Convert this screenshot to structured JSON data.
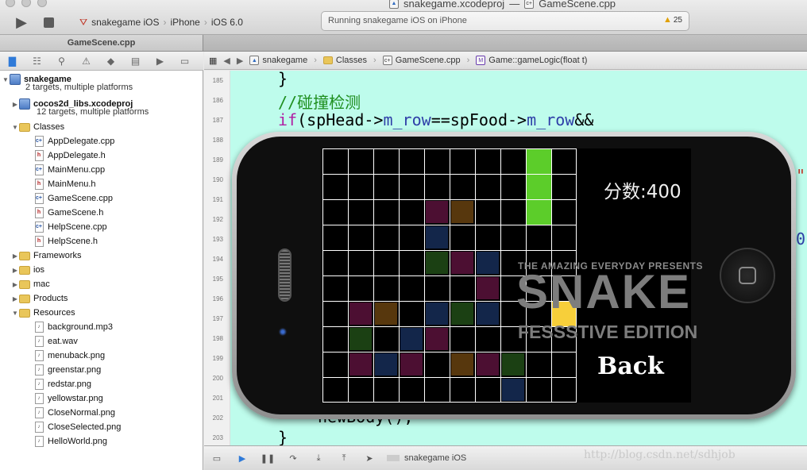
{
  "window": {
    "project_file": "snakegame.xcodeproj",
    "dash": "—",
    "source_file": "GameScene.cpp"
  },
  "toolbar": {
    "scheme": "snakegame iOS",
    "device": "iPhone",
    "os": "iOS 6.0",
    "status": "Running snakegame iOS on iPhone",
    "warnings": "25"
  },
  "tab": {
    "label": "GameScene.cpp"
  },
  "navigator": {
    "project": {
      "name": "snakegame",
      "subtitle": "2 targets, multiple platforms"
    },
    "libs": {
      "name": "cocos2d_libs.xcodeproj",
      "subtitle": "12 targets, multiple platforms"
    },
    "classes_label": "Classes",
    "classes": [
      {
        "name": "AppDelegate.cpp",
        "kind": "cpp"
      },
      {
        "name": "AppDelegate.h",
        "kind": "h"
      },
      {
        "name": "MainMenu.cpp",
        "kind": "cpp"
      },
      {
        "name": "MainMenu.h",
        "kind": "h"
      },
      {
        "name": "GameScene.cpp",
        "kind": "cpp"
      },
      {
        "name": "GameScene.h",
        "kind": "h"
      },
      {
        "name": "HelpScene.cpp",
        "kind": "cpp"
      },
      {
        "name": "HelpScene.h",
        "kind": "h"
      }
    ],
    "groups": [
      "Frameworks",
      "ios",
      "mac",
      "Products"
    ],
    "resources_label": "Resources",
    "resources": [
      "background.mp3",
      "eat.wav",
      "menuback.png",
      "greenstar.png",
      "redstar.png",
      "yellowstar.png",
      "CloseNormal.png",
      "CloseSelected.png",
      "HelloWorld.png"
    ]
  },
  "jumpbar": {
    "project": "snakegame",
    "group": "Classes",
    "file": "GameScene.cpp",
    "method_badge": "M",
    "method": "Game::gameLogic(float t)"
  },
  "editor": {
    "line_numbers": [
      "185",
      "186",
      "187",
      "188",
      "189",
      "190",
      "191",
      "192",
      "193",
      "194",
      "195",
      "196",
      "197",
      "198",
      "199",
      "200",
      "201",
      "202",
      "203"
    ],
    "code_line_185": "}",
    "code_comment": "//碰撞检测",
    "code_if": "if",
    "code_if_rest_1": "(spHead->",
    "code_m_row": "m_row",
    "code_eq": "==spFood->",
    "code_m_row2": "m_row",
    "code_and": "&&",
    "code_line_201": "newBody();",
    "code_line_203": "}",
    "code_edge_1": "\"",
    "code_edge_2": "0"
  },
  "debug": {
    "scheme": "snakegame iOS"
  },
  "watermark": "http://blog.csdn.net/sdhjob",
  "game": {
    "score": "分数:400",
    "logo_top": "THE AMAZING EVERYDAY PRESENTS",
    "logo_main": "SNAKE",
    "logo_sub": "FESSSTIVE EDITION",
    "back": "Back",
    "snake_color": "#5ccd2a",
    "food_color": "#f7cf3a",
    "grid_color": "#ffffff"
  }
}
